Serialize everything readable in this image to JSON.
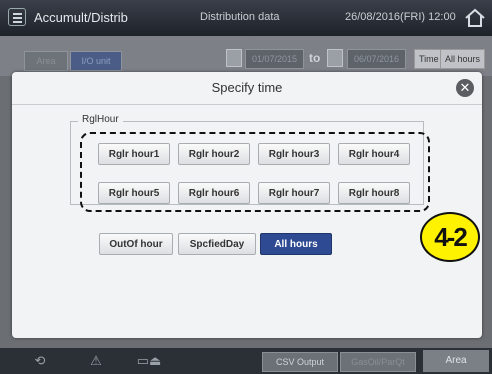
{
  "topbar": {
    "title": "Accumult/Distrib",
    "subtitle": "Distribution data",
    "datetime": "26/08/2016(FRI) 12:00"
  },
  "background": {
    "tab_area": "Area",
    "tab_io": "I/O unit",
    "date_from": "01/07/2015",
    "to_label": "to",
    "date_to": "06/07/2016",
    "time_label": "Time",
    "allhours_label": "All hours"
  },
  "dialog": {
    "title": "Specify time",
    "group_label": "RglHour",
    "regular_hours": [
      "Rglr hour1",
      "Rglr hour2",
      "Rglr hour3",
      "Rglr hour4",
      "Rglr hour5",
      "Rglr hour6",
      "Rglr hour7",
      "Rglr hour8"
    ],
    "options": [
      "OutOf hour",
      "SpcfiedDay",
      "All hours"
    ],
    "selected_option": "All hours"
  },
  "callout": {
    "label": "4-2",
    "color": "#fff200"
  },
  "footer": {
    "csv": "CSV Output",
    "dim_btn": "GasOil/ParQt",
    "area": "Area"
  },
  "icons": {
    "menu": "menu-icon",
    "home": "home-icon",
    "close": "close-icon",
    "back": "back-icon",
    "warning": "warning-icon",
    "eject": "eject-icon",
    "calendar": "calendar-icon"
  },
  "colors": {
    "accent": "#2d4a92",
    "highlight": "#fff200"
  }
}
